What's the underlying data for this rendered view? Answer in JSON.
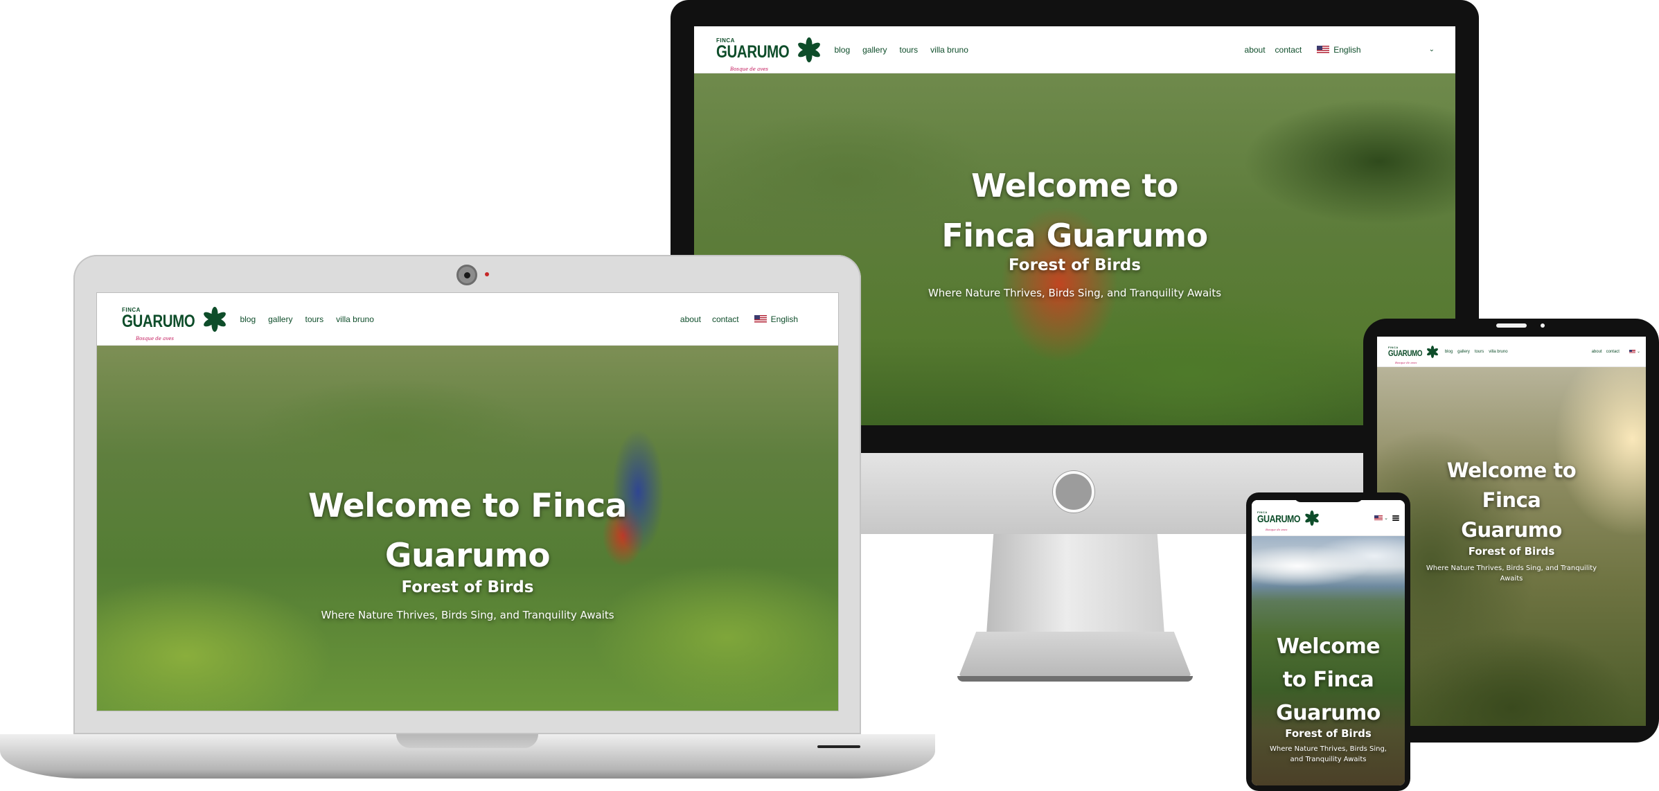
{
  "site": {
    "logo_finca": "FINCA",
    "logo_guarumo": "GUARUMO",
    "logo_tagline": "Bosque de aves",
    "nav_links": [
      "blog",
      "gallery",
      "tours",
      "villa bruno"
    ],
    "about": "about",
    "contact": "contact",
    "language": "English",
    "hero_title": "Welcome to Finca Guarumo",
    "hero_subtitle": "Forest of Birds",
    "hero_tagline": "Where Nature Thrives, Birds Sing, and Tranquility Awaits"
  },
  "colors": {
    "brand_green": "#0e4d2a",
    "tagline_pink": "#c2185b"
  },
  "icons": {
    "logo_mark": "guarumo-leaf-icon",
    "flag": "us-flag-icon",
    "dropdown": "chevron-down-icon",
    "menu": "hamburger-menu-icon"
  }
}
